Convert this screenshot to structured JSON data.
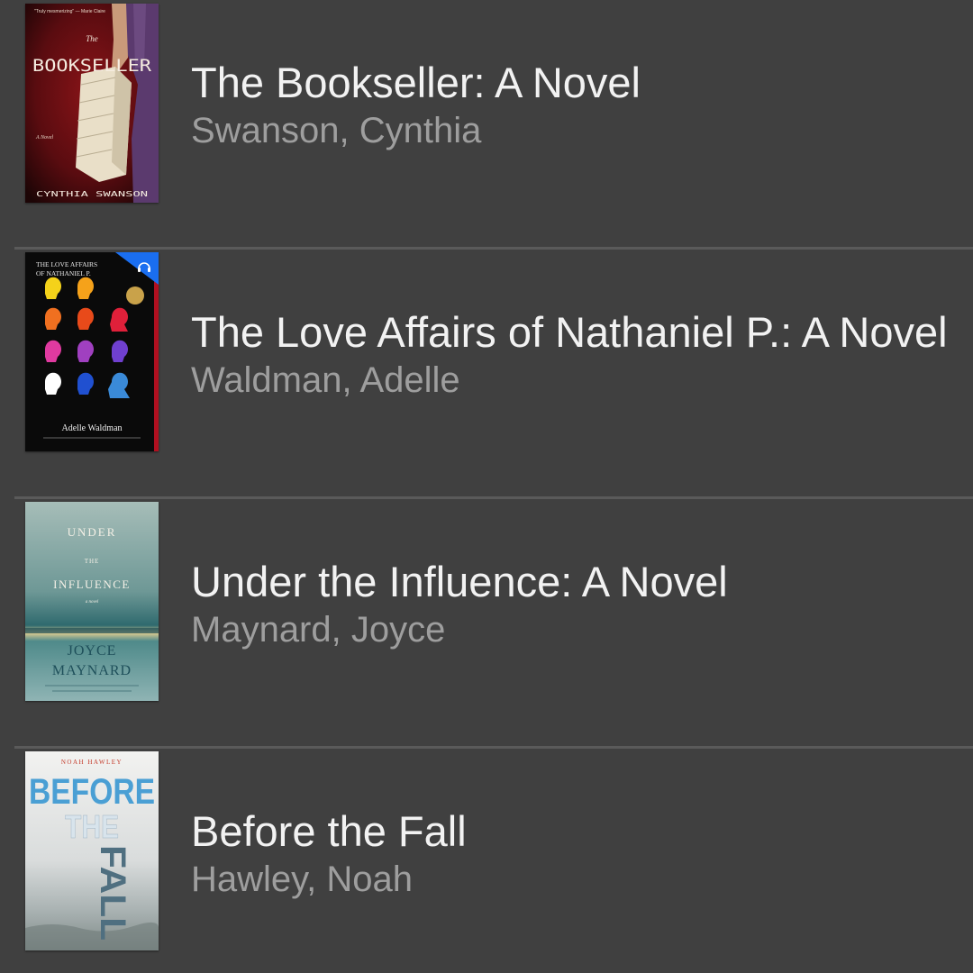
{
  "books": [
    {
      "title": "The Bookseller: A Novel",
      "author": "Swanson, Cynthia",
      "cover": {
        "top_text": "\"Truly mesmerizing\" — Marie Claire",
        "small_the": "The",
        "title_text": "BOOKSELLER",
        "sub_text": "A Novel",
        "author_text": "CYNTHIA SWANSON"
      }
    },
    {
      "title": "The Love Affairs of Nathaniel P.: A Novel",
      "author": "Waldman, Adelle",
      "cover": {
        "title_line1": "THE LOVE AFFAIRS",
        "title_line2": "OF NATHANIEL P.",
        "author_text": "Adelle Waldman",
        "badge_icon": "headphones-icon"
      }
    },
    {
      "title": "Under the Influence: A Novel",
      "author": "Maynard, Joyce",
      "cover": {
        "line1": "UNDER",
        "line2": "THE",
        "line3": "INFLUENCE",
        "sub_text": "a novel",
        "author_line1": "JOYCE",
        "author_line2": "MAYNARD"
      }
    },
    {
      "title": "Before the Fall",
      "author": "Hawley, Noah",
      "cover": {
        "author_text": "NOAH HAWLEY",
        "word1": "BEFORE",
        "word2": "THE",
        "word3": "FALL"
      }
    }
  ]
}
